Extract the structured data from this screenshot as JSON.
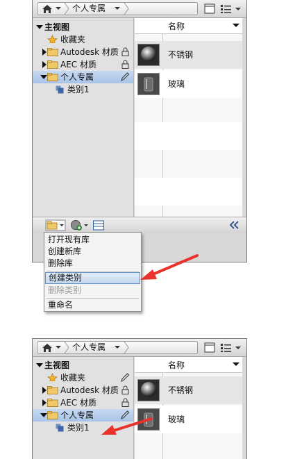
{
  "top_panel": {
    "breadcrumb": {
      "home_icon": "home-icon",
      "current": "个人专属"
    },
    "view_icons": [
      "single-pane-icon",
      "list-view-icon"
    ],
    "tree": [
      {
        "label": "主视图",
        "kind": "root",
        "expanded": true
      },
      {
        "label": "收藏夹",
        "icon": "star-icon"
      },
      {
        "label": "Autodesk 材质",
        "icon": "folder-icon",
        "locked": true,
        "collapsed": true
      },
      {
        "label": "AEC 材质",
        "icon": "folder-icon",
        "locked": true,
        "collapsed": true
      },
      {
        "label": "个人专属",
        "icon": "folder-icon",
        "selected": true,
        "editable": true
      },
      {
        "label": "类别1",
        "icon": "category-icon"
      }
    ],
    "grid_header": "名称",
    "materials": [
      {
        "name": "不锈钢",
        "thumb": "sphere"
      },
      {
        "name": "玻璃",
        "thumb": "glass"
      }
    ]
  },
  "context_menu": {
    "items": [
      {
        "label": "打开现有库",
        "state": "normal"
      },
      {
        "label": "创建新库",
        "state": "normal"
      },
      {
        "label": "删除库",
        "state": "normal"
      },
      {
        "label": "创建类别",
        "state": "highlighted"
      },
      {
        "label": "删除类别",
        "state": "disabled"
      },
      {
        "label": "重命名",
        "state": "normal"
      }
    ]
  },
  "bottom_panel": {
    "breadcrumb": {
      "current": "个人专属"
    },
    "tree": [
      {
        "label": "主视图"
      },
      {
        "label": "收藏夹"
      },
      {
        "label": "Autodesk 材质"
      },
      {
        "label": "AEC 材质"
      },
      {
        "label": "个人专属"
      },
      {
        "label": "类别1"
      }
    ],
    "grid_header": "名称",
    "materials": [
      {
        "name": "不锈钢"
      },
      {
        "name": "玻璃"
      }
    ]
  },
  "colors": {
    "arrow": "#e8322b",
    "selection": "#b6cdeb",
    "panel_bg": "#d8d8d8"
  }
}
